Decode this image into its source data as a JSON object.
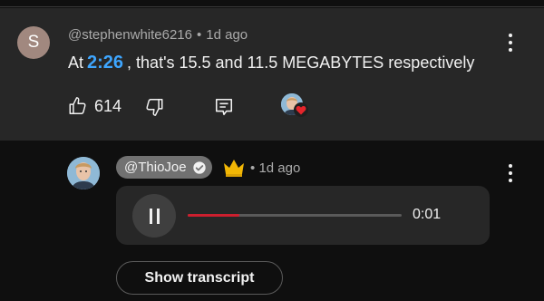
{
  "comment": {
    "avatar_letter": "S",
    "author": "@stephenwhite6216",
    "separator": "•",
    "time": "1d ago",
    "text_before": "At",
    "timestamp": "2:26",
    "text_after": ", that's 15.5 and 11.5 MEGABYTES respectively",
    "like_count": "614",
    "icons": [
      "thumbs-up-icon",
      "thumbs-down-icon",
      "reply-icon",
      "creator-heart-icon",
      "more-vert-icon"
    ]
  },
  "reply": {
    "author": "@ThioJoe",
    "separator": "•",
    "time": "1d ago",
    "icons": [
      "verified-check-icon",
      "crown-icon",
      "pause-icon",
      "more-vert-icon"
    ],
    "voice": {
      "elapsed": "0:01",
      "progress_fraction": 0.24
    },
    "transcript_label": "Show transcript"
  },
  "colors": {
    "link": "#3ea6ff",
    "progress": "#cc1f2e",
    "heart": "#e5252b",
    "crown": "#f2b705"
  }
}
